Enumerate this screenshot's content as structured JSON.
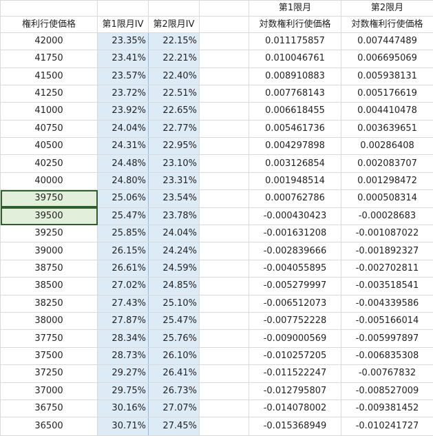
{
  "headers": {
    "row1": {
      "c1": "",
      "c2": "",
      "c3": "",
      "c4": "",
      "c5": "第1限月",
      "c6": "第2限月"
    },
    "row2": {
      "c1": "権利行使価格",
      "c2": "第1限月IV",
      "c3": "第2限月IV",
      "c4": "",
      "c5": "対数権利行使価格",
      "c6": "対数権利行使価格"
    }
  },
  "rows": [
    {
      "strike": "42000",
      "iv1": "23.35%",
      "iv2": "22.15%",
      "log1": "0.011175857",
      "log2": "0.007447489"
    },
    {
      "strike": "41750",
      "iv1": "23.41%",
      "iv2": "22.21%",
      "log1": "0.010046761",
      "log2": "0.006695069"
    },
    {
      "strike": "41500",
      "iv1": "23.57%",
      "iv2": "22.40%",
      "log1": "0.008910883",
      "log2": "0.005938131"
    },
    {
      "strike": "41250",
      "iv1": "23.72%",
      "iv2": "22.51%",
      "log1": "0.007768143",
      "log2": "0.005176619"
    },
    {
      "strike": "41000",
      "iv1": "23.92%",
      "iv2": "22.65%",
      "log1": "0.006618455",
      "log2": "0.004410478"
    },
    {
      "strike": "40750",
      "iv1": "24.04%",
      "iv2": "22.77%",
      "log1": "0.005461736",
      "log2": "0.003639651"
    },
    {
      "strike": "40500",
      "iv1": "24.31%",
      "iv2": "22.95%",
      "log1": "0.004297898",
      "log2": "0.00286408"
    },
    {
      "strike": "40250",
      "iv1": "24.48%",
      "iv2": "23.10%",
      "log1": "0.003126854",
      "log2": "0.002083707"
    },
    {
      "strike": "40000",
      "iv1": "24.80%",
      "iv2": "23.31%",
      "log1": "0.001948514",
      "log2": "0.001298472"
    },
    {
      "strike": "39750",
      "iv1": "25.06%",
      "iv2": "23.54%",
      "log1": "0.000762786",
      "log2": "0.000508314",
      "selected": true
    },
    {
      "strike": "39500",
      "iv1": "25.47%",
      "iv2": "23.78%",
      "log1": "-0.000430423",
      "log2": "-0.00028683",
      "selected": true
    },
    {
      "strike": "39250",
      "iv1": "25.85%",
      "iv2": "24.04%",
      "log1": "-0.001631208",
      "log2": "-0.001087022"
    },
    {
      "strike": "39000",
      "iv1": "26.15%",
      "iv2": "24.24%",
      "log1": "-0.002839666",
      "log2": "-0.001892327"
    },
    {
      "strike": "38750",
      "iv1": "26.61%",
      "iv2": "24.59%",
      "log1": "-0.004055895",
      "log2": "-0.002702811"
    },
    {
      "strike": "38500",
      "iv1": "27.02%",
      "iv2": "24.85%",
      "log1": "-0.005279997",
      "log2": "-0.003518541"
    },
    {
      "strike": "38250",
      "iv1": "27.43%",
      "iv2": "25.10%",
      "log1": "-0.006512073",
      "log2": "-0.004339586"
    },
    {
      "strike": "38000",
      "iv1": "27.87%",
      "iv2": "25.47%",
      "log1": "-0.007752228",
      "log2": "-0.005166014"
    },
    {
      "strike": "37750",
      "iv1": "28.34%",
      "iv2": "25.76%",
      "log1": "-0.009000569",
      "log2": "-0.005997897"
    },
    {
      "strike": "37500",
      "iv1": "28.73%",
      "iv2": "26.10%",
      "log1": "-0.010257205",
      "log2": "-0.006835308"
    },
    {
      "strike": "37250",
      "iv1": "29.27%",
      "iv2": "26.41%",
      "log1": "-0.011522247",
      "log2": "-0.00767832"
    },
    {
      "strike": "37000",
      "iv1": "29.75%",
      "iv2": "26.73%",
      "log1": "-0.012795807",
      "log2": "-0.008527009"
    },
    {
      "strike": "36750",
      "iv1": "30.16%",
      "iv2": "27.07%",
      "log1": "-0.014078002",
      "log2": "-0.009381452"
    },
    {
      "strike": "36500",
      "iv1": "30.71%",
      "iv2": "27.45%",
      "log1": "-0.015368949",
      "log2": "-0.010241727"
    }
  ],
  "colors": {
    "iv_fill": "#ddebf7",
    "selected_fill": "#e2efda",
    "selected_border": "#2e5e2e",
    "gridline": "#d9d9d9"
  }
}
